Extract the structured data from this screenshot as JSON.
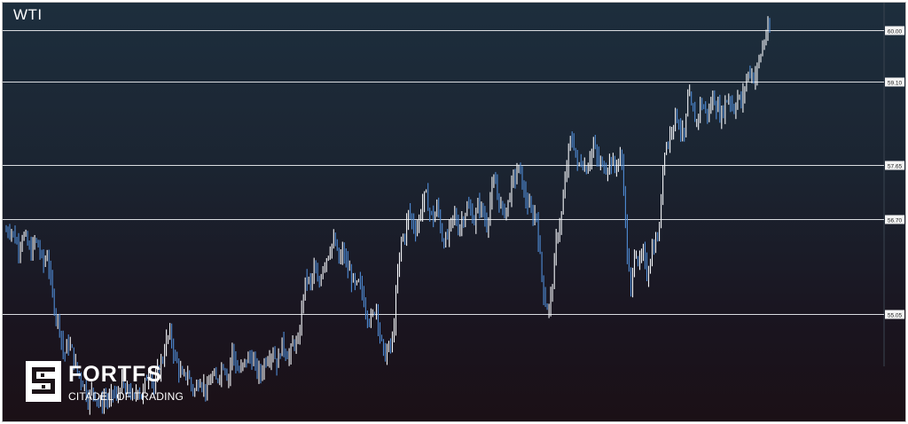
{
  "title": "WTI",
  "brand": {
    "name": "FORTFS",
    "tagline": "CITADEL OF TRADING"
  },
  "colors": {
    "bull": "#f5f7fa",
    "bear": "#4f8cd6",
    "level_line": "#d9dce0",
    "label_bg": "#f4f4f4",
    "label_text": "#222222"
  },
  "chart_data": {
    "type": "line",
    "ylim": [
      53.18,
      60.48
    ],
    "grid": false,
    "levels": [
      {
        "value": 60.0,
        "label": "60.00"
      },
      {
        "value": 59.1,
        "label": "59.10"
      },
      {
        "value": 57.65,
        "label": "57.65"
      },
      {
        "value": 56.7,
        "label": "56.70"
      },
      {
        "value": 55.05,
        "label": "55.05"
      }
    ],
    "series": [
      {
        "values": [
          56.5,
          56.55,
          56.4,
          56.2,
          56.45,
          56.3,
          56.1,
          56.35,
          56.2,
          55.9,
          56.1,
          55.5,
          55.05,
          54.85,
          54.3,
          54.55,
          54.4,
          54.1,
          53.95,
          53.8,
          53.55,
          53.75,
          53.6,
          53.45,
          53.62,
          53.5,
          53.7,
          53.55,
          53.9,
          53.65,
          53.75,
          53.5,
          53.8,
          53.6,
          53.9,
          54.15,
          53.7,
          54.1,
          54.25,
          54.6,
          54.7,
          54.3,
          54.1,
          53.9,
          54.05,
          53.8,
          53.7,
          53.95,
          53.8,
          53.7,
          54.0,
          53.85,
          54.05,
          54.2,
          53.9,
          54.45,
          54.1,
          54.05,
          54.2,
          54.3,
          54.25,
          54.05,
          54.0,
          54.25,
          54.35,
          54.4,
          54.15,
          54.55,
          54.4,
          54.3,
          54.6,
          54.45,
          55.25,
          55.7,
          55.55,
          55.85,
          55.5,
          55.9,
          56.05,
          56.25,
          56.3,
          55.95,
          56.15,
          55.85,
          55.7,
          55.5,
          55.6,
          55.3,
          55.0,
          54.95,
          55.25,
          54.65,
          54.3,
          54.45,
          54.55,
          55.5,
          56.3,
          56.45,
          56.85,
          56.6,
          56.55,
          56.9,
          57.15,
          56.85,
          56.7,
          56.95,
          56.4,
          56.3,
          56.55,
          56.8,
          56.55,
          56.7,
          56.9,
          56.85,
          56.65,
          57.0,
          56.8,
          56.6,
          57.15,
          57.35,
          57.0,
          56.8,
          56.95,
          57.3,
          57.5,
          57.6,
          57.15,
          56.95,
          56.75,
          56.8,
          55.95,
          55.3,
          55.1,
          55.6,
          56.45,
          56.7,
          57.35,
          58.0,
          58.1,
          57.6,
          57.75,
          57.55,
          57.8,
          58.0,
          57.7,
          57.65,
          57.6,
          57.75,
          57.6,
          57.75,
          57.7,
          56.2,
          55.4,
          56.25,
          55.9,
          56.1,
          55.7,
          56.15,
          56.3,
          56.55,
          57.95,
          58.0,
          58.35,
          58.55,
          58.3,
          58.1,
          58.9,
          58.55,
          58.4,
          58.75,
          58.6,
          58.55,
          58.85,
          58.65,
          58.5,
          58.75,
          58.85,
          58.6,
          58.85,
          58.7,
          59.15,
          59.3,
          59.15,
          59.4,
          59.7,
          59.95,
          60.0
        ]
      }
    ]
  }
}
